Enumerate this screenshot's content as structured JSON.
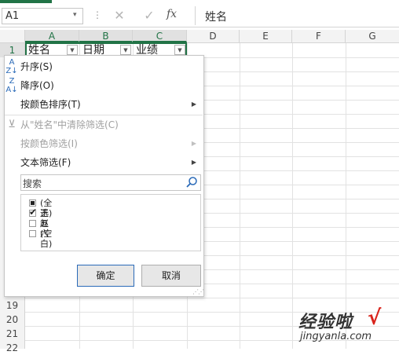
{
  "formula_bar": {
    "name_box": "A1",
    "name_box_arrow": "▾",
    "separator": "⋮",
    "cancel_icon": "✕",
    "enter_icon": "✓",
    "fx_label": "fx",
    "formula_value": "姓名"
  },
  "grid": {
    "columns": [
      "A",
      "B",
      "C",
      "D",
      "E",
      "F",
      "G"
    ],
    "selected_columns": [
      "A",
      "B",
      "C"
    ],
    "header_cells": [
      "姓名",
      "日期",
      "业绩"
    ],
    "filter_arrow": "▼",
    "row_numbers_top": [
      "1"
    ],
    "row_numbers_bottom": [
      "19",
      "20",
      "21",
      "22"
    ]
  },
  "filter_menu": {
    "sort_ascending": "升序(S)",
    "sort_descending": "降序(O)",
    "sort_by_color": "按颜色排序(T)",
    "clear_filter": "从\"姓名\"中清除筛选(C)",
    "filter_by_color": "按颜色筛选(I)",
    "text_filters": "文本筛选(F)",
    "submenu_arrow": "▶",
    "search_placeholder": "搜索",
    "values": [
      {
        "label": "(全选)",
        "state": "partial"
      },
      {
        "label": "王五",
        "state": "checked"
      },
      {
        "label": "赵六",
        "state": "unchecked"
      },
      {
        "label": "(空白)",
        "state": "unchecked"
      }
    ],
    "ok_label": "确定",
    "cancel_label": "取消"
  },
  "colors": {
    "accent": "#217346",
    "link_blue": "#2a6ab8",
    "watermark_check": "#d9241c"
  },
  "watermark": {
    "text": "经验啦",
    "check": "√",
    "url": "jingyanla.com"
  }
}
